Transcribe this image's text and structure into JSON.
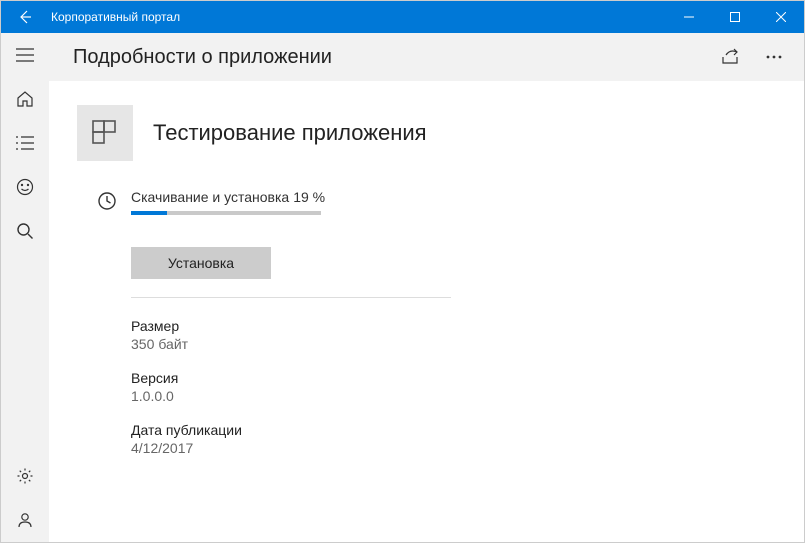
{
  "titlebar": {
    "app_name": "Корпоративный портал"
  },
  "header": {
    "title": "Подробности о приложении"
  },
  "app": {
    "name": "Тестирование приложения"
  },
  "status": {
    "label": "Скачивание и установка",
    "percent_text": "19 %",
    "percent_value": 19
  },
  "actions": {
    "install_label": "Установка"
  },
  "meta": {
    "size": {
      "label": "Размер",
      "value_num": "350",
      "value_unit": "байт"
    },
    "version": {
      "label": "Версия",
      "value": "1.0.0.0"
    },
    "published": {
      "label": "Дата публикации",
      "value": "4/12/2017"
    }
  },
  "colors": {
    "accent": "#0078d7"
  }
}
